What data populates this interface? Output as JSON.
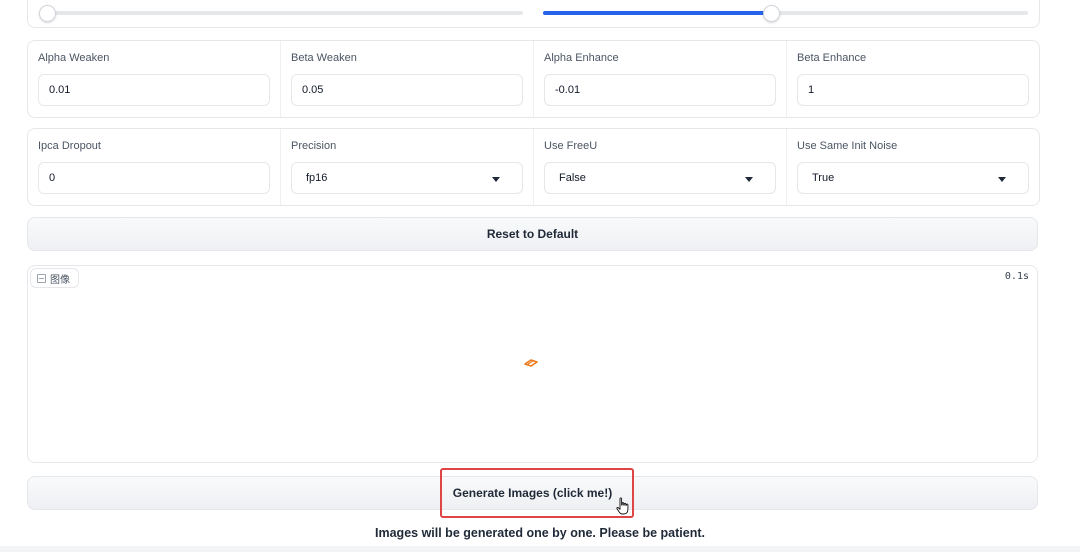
{
  "sliders": [
    {
      "value_fraction": 0.0
    },
    {
      "value_fraction": 0.47
    }
  ],
  "row1": [
    {
      "label": "Alpha Weaken",
      "value": "0.01"
    },
    {
      "label": "Beta Weaken",
      "value": "0.05"
    },
    {
      "label": "Alpha Enhance",
      "value": "-0.01"
    },
    {
      "label": "Beta Enhance",
      "value": "1"
    }
  ],
  "row2": {
    "ipca": {
      "label": "Ipca Dropout",
      "value": "0"
    },
    "precision": {
      "label": "Precision",
      "value": "fp16"
    },
    "freeu": {
      "label": "Use FreeU",
      "value": "False"
    },
    "same_noise": {
      "label": "Use Same Init Noise",
      "value": "True"
    }
  },
  "reset_label": "Reset to Default",
  "image_panel": {
    "tag_label": "图像",
    "timer": "0.1s",
    "loader_icon": "loading-spinner-icon"
  },
  "generate_label": "Generate Images (click me!)",
  "note": "Images will be generated one by one. Please be patient.",
  "colors": {
    "accent": "#2563eb",
    "highlight": "#e04545",
    "loader": "#ea7a1a"
  }
}
